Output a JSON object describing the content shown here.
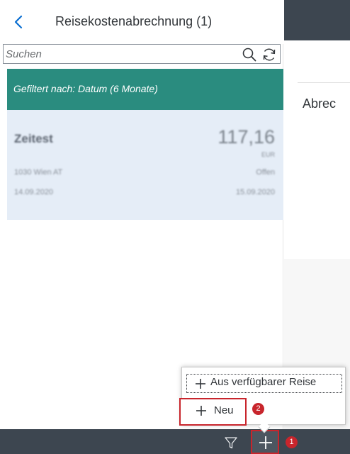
{
  "header": {
    "title": "Reisekostenabrechnung (1)",
    "back_icon": "chevron-left-icon"
  },
  "search": {
    "placeholder": "Suchen",
    "value": "",
    "search_icon": "search-icon",
    "refresh_icon": "refresh-icon"
  },
  "filter_bar": {
    "text": "Gefiltert nach: Datum (6 Monate)"
  },
  "list": {
    "items": [
      {
        "title": "Zeitest",
        "amount": "117,16",
        "currency": "EUR",
        "location": "1030 Wien AT",
        "status": "Offen",
        "date_start": "14.09.2020",
        "date_end": "15.09.2020"
      }
    ]
  },
  "detail": {
    "title": "Abrec"
  },
  "popover": {
    "items": [
      {
        "label": "Aus verfügbarer Reise",
        "icon": "plus-icon"
      },
      {
        "label": "Neu",
        "icon": "plus-icon"
      }
    ]
  },
  "footer": {
    "filter_icon": "filter-icon",
    "add_icon": "plus-icon"
  },
  "badges": [
    "1",
    "2"
  ],
  "colors": {
    "accent": "#0a6ed1",
    "filter_bar": "#2a8c7f",
    "list_item_bg": "#e5edf7",
    "shell_dark": "#3d4650",
    "callout_red": "#c8252c"
  }
}
